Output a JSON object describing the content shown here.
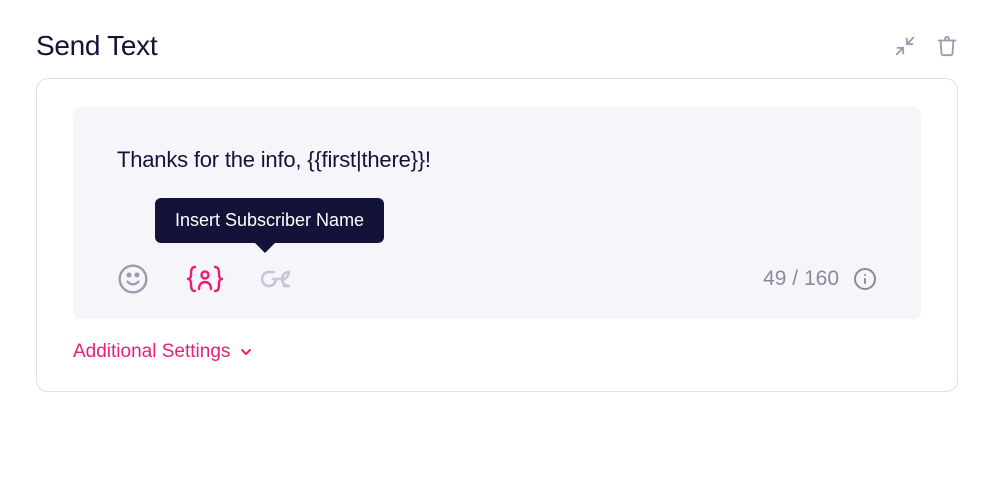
{
  "header": {
    "title": "Send Text"
  },
  "editor": {
    "message": "Thanks for the info, {{first|there}}!",
    "char_count": "49 / 160",
    "tooltip": "Insert Subscriber Name"
  },
  "footer": {
    "additional_settings_label": "Additional Settings"
  }
}
